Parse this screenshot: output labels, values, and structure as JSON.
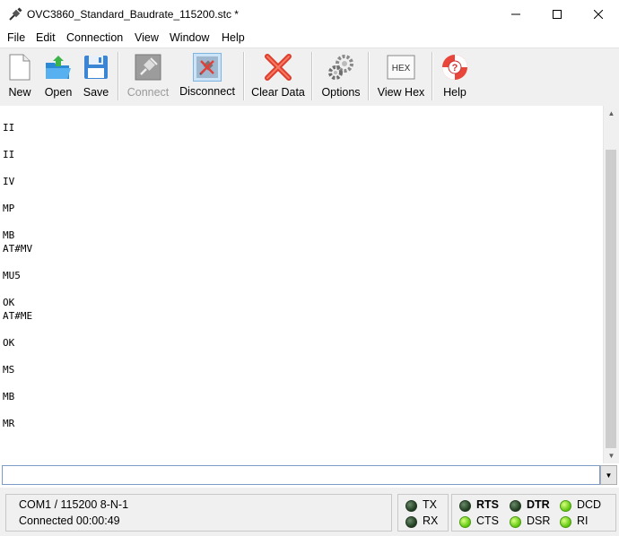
{
  "window": {
    "title": "OVC3860_Standard_Baudrate_115200.stc *",
    "minimize_icon": "minimize-icon",
    "maximize_icon": "maximize-icon",
    "close_icon": "close-icon"
  },
  "menu": {
    "items": [
      "File",
      "Edit",
      "Connection",
      "View",
      "Window",
      "Help"
    ]
  },
  "toolbar": {
    "buttons": [
      {
        "label": "New",
        "icon": "new-document-icon",
        "enabled": true
      },
      {
        "label": "Open",
        "icon": "open-folder-icon",
        "enabled": true
      },
      {
        "label": "Save",
        "icon": "save-floppy-icon",
        "enabled": true
      },
      {
        "label": "Connect",
        "icon": "connect-plug-icon",
        "enabled": false
      },
      {
        "label": "Disconnect",
        "icon": "disconnect-plug-icon",
        "enabled": true,
        "pressed": true
      },
      {
        "label": "Clear Data",
        "icon": "clear-x-icon",
        "enabled": true
      },
      {
        "label": "Options",
        "icon": "gears-icon",
        "enabled": true
      },
      {
        "label": "View Hex",
        "icon": "hex-icon",
        "enabled": true,
        "icon_text": "HEX"
      },
      {
        "label": "Help",
        "icon": "lifebuoy-help-icon",
        "enabled": true
      }
    ]
  },
  "terminal": {
    "lines": [
      "II",
      "II",
      "IV",
      "MP",
      "MB",
      "AT#MV",
      "MU5",
      "OK",
      "AT#ME",
      "OK",
      "MS",
      "MB",
      "MR"
    ]
  },
  "input": {
    "value": ""
  },
  "status": {
    "port": "COM1 / 115200 8-N-1",
    "connection": "Connected 00:00:49"
  },
  "signals": {
    "tx": {
      "label": "TX",
      "state": "off"
    },
    "rx": {
      "label": "RX",
      "state": "off"
    },
    "rts": {
      "label": "RTS",
      "state": "off"
    },
    "cts": {
      "label": "CTS",
      "state": "on"
    },
    "dtr": {
      "label": "DTR",
      "state": "off"
    },
    "dsr": {
      "label": "DSR",
      "state": "on"
    },
    "dcd": {
      "label": "DCD",
      "state": "on"
    },
    "ri": {
      "label": "RI",
      "state": "on"
    }
  },
  "colors": {
    "led_on": "#5cc40a",
    "led_off": "#1d3a1d",
    "input_border": "#7a9cc7"
  }
}
